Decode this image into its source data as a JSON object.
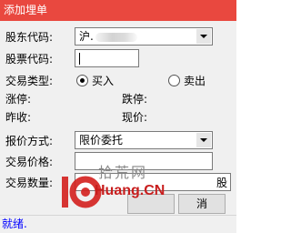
{
  "window": {
    "title": "添加埋单"
  },
  "form": {
    "shareholder_code": {
      "label": "股东代码:",
      "value": "沪."
    },
    "stock_code": {
      "label": "股票代码:",
      "value": ""
    },
    "trade_type": {
      "label": "交易类型:",
      "options": [
        "买入",
        "卖出"
      ],
      "selected": "买入"
    },
    "limit_up_label": "涨停:",
    "limit_down_label": "跌停:",
    "prev_close_label": "昨收:",
    "current_price_label": "现价:",
    "quote_method": {
      "label": "报价方式:",
      "value": "限价委托"
    },
    "trade_price": {
      "label": "交易价格:",
      "value": ""
    },
    "trade_quantity": {
      "label": "交易数量:",
      "value": "",
      "unit": "股"
    }
  },
  "buttons": {
    "confirm_label": "",
    "cancel_label": "消"
  },
  "status": {
    "text": "就绪."
  },
  "watermark": {
    "text_cn": "拾荒网",
    "text_en": "Huang.CN",
    "logo_number": "10"
  },
  "colors": {
    "titlebar": "#e9483f",
    "status_text": "#0000ff",
    "panel": "#f0f0f0"
  }
}
